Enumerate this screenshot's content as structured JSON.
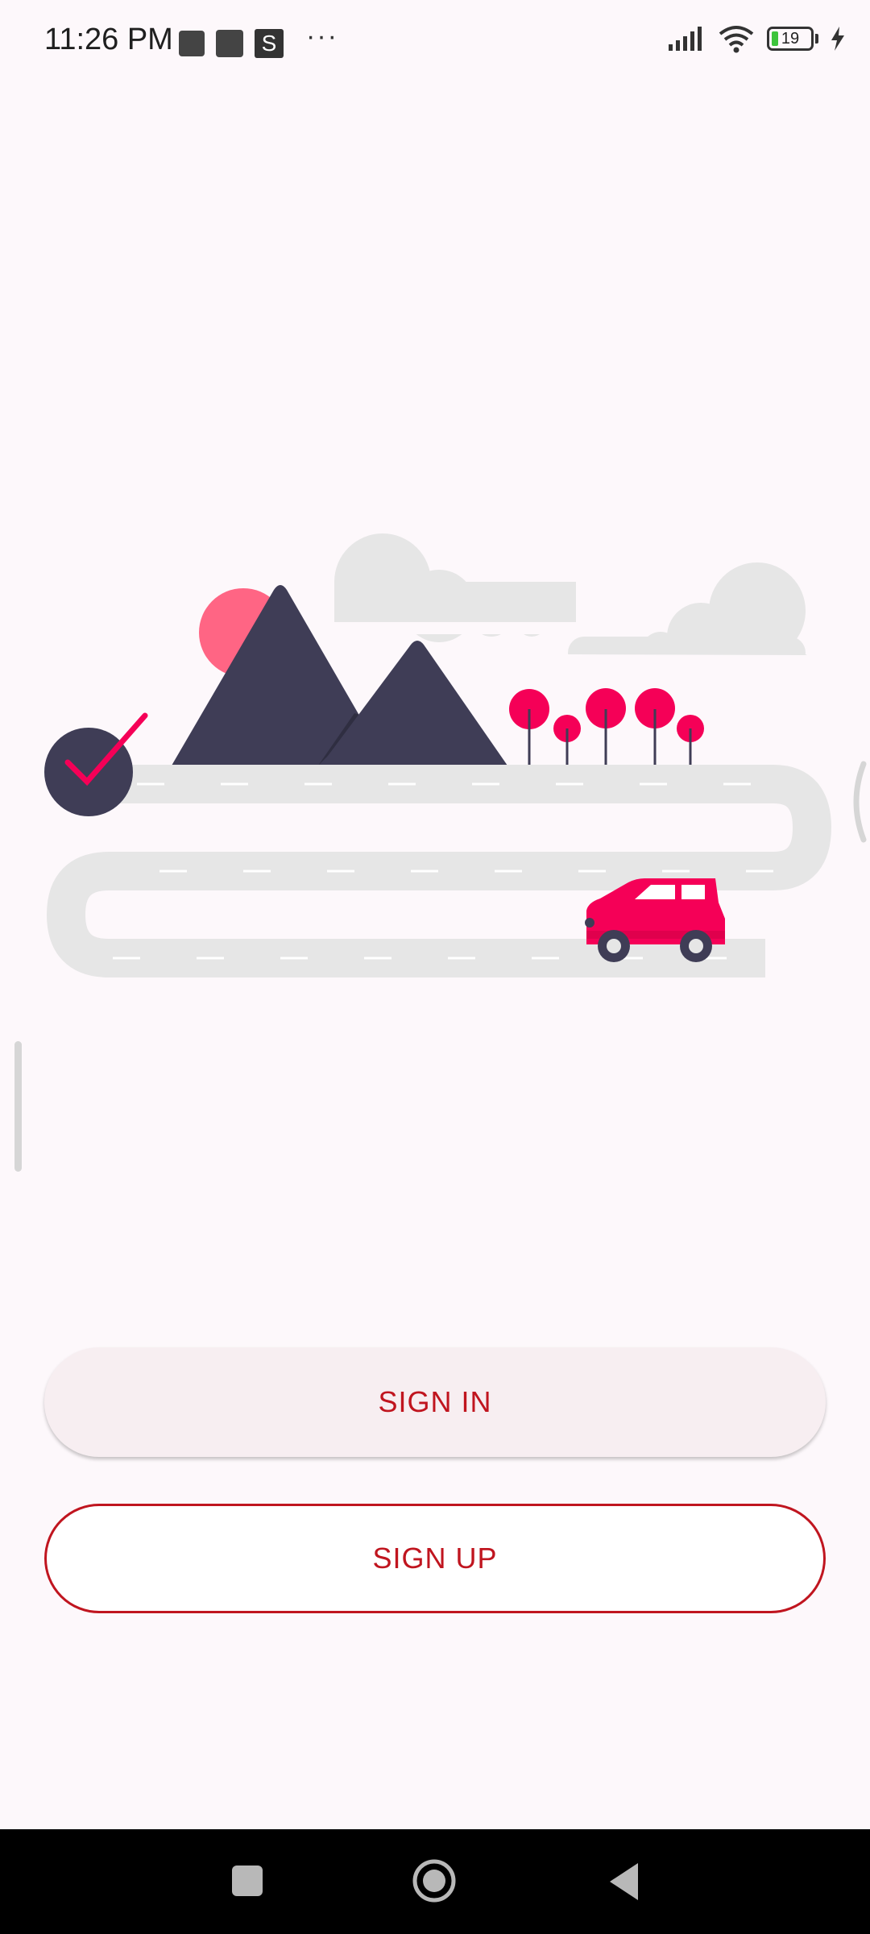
{
  "status_bar": {
    "time": "11:26 PM",
    "notification_s": "S",
    "more": "···",
    "battery_level": "19",
    "icons": [
      "signal-icon",
      "wifi-icon",
      "battery-icon",
      "charging-icon"
    ]
  },
  "illustration": {
    "description_icon": "road-trip-illustration",
    "colors": {
      "accent": "#f50057",
      "dark": "#3f3d56",
      "road": "#e6e6e6",
      "sun": "#ff6584"
    }
  },
  "actions": {
    "sign_in_label": "SIGN IN",
    "sign_up_label": "SIGN UP"
  },
  "colors": {
    "background": "#fdf8fb",
    "button_text": "#c0151f",
    "sign_in_bg": "#f7eef1"
  },
  "nav": {
    "icons": [
      "recents-icon",
      "home-icon",
      "back-icon"
    ]
  }
}
